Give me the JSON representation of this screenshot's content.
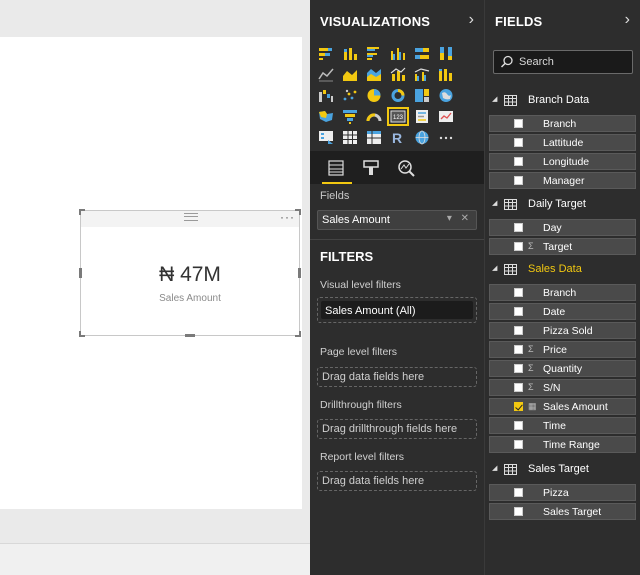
{
  "card": {
    "value": "₦ 47M",
    "label": "Sales Amount",
    "more_glyph": "···"
  },
  "visualizations": {
    "title": "VISUALIZATIONS",
    "icons": [
      "stacked-bar-icon",
      "stacked-column-icon",
      "clustered-bar-icon",
      "clustered-column-icon",
      "100-percent-bar-icon",
      "100-percent-column-icon",
      "line-chart-icon",
      "area-chart-icon",
      "stacked-area-icon",
      "line-column-icon",
      "line-clustered-column-icon",
      "ribbon-chart-icon",
      "waterfall-icon",
      "scatter-icon",
      "pie-chart-icon",
      "donut-chart-icon",
      "treemap-icon",
      "map-icon",
      "filled-map-icon",
      "funnel-icon",
      "gauge-icon",
      "card-icon",
      "multi-row-card-icon",
      "kpi-icon",
      "slicer-icon",
      "table-icon",
      "matrix-icon",
      "r-visual-icon",
      "globe-icon",
      "more-icon"
    ],
    "tabs": [
      "fields-tab-icon",
      "format-tab-icon",
      "analytics-tab-icon"
    ],
    "fields_label": "Fields",
    "well_value": "Sales Amount",
    "well_controls": "▾ ✕"
  },
  "filters": {
    "title": "FILTERS",
    "visual_level_label": "Visual level filters",
    "visual_filter": "Sales Amount  (All)",
    "page_level_label": "Page level filters",
    "page_drop": "Drag data fields here",
    "drillthrough_label": "Drillthrough filters",
    "drillthrough_drop": "Drag drillthrough fields here",
    "report_level_label": "Report level filters",
    "report_drop": "Drag data fields here"
  },
  "fields": {
    "title": "FIELDS",
    "search_placeholder": "Search",
    "tables": [
      {
        "name": "Branch Data",
        "active": false,
        "fields": [
          {
            "label": "Branch",
            "type": "",
            "checked": false
          },
          {
            "label": "Lattitude",
            "type": "",
            "checked": false
          },
          {
            "label": "Longitude",
            "type": "",
            "checked": false
          },
          {
            "label": "Manager",
            "type": "",
            "checked": false
          }
        ]
      },
      {
        "name": "Daily Target",
        "active": false,
        "fields": [
          {
            "label": "Day",
            "type": "",
            "checked": false
          },
          {
            "label": "Target",
            "type": "Σ",
            "checked": false
          }
        ]
      },
      {
        "name": "Sales Data",
        "active": true,
        "fields": [
          {
            "label": "Branch",
            "type": "",
            "checked": false
          },
          {
            "label": "Date",
            "type": "",
            "checked": false
          },
          {
            "label": "Pizza Sold",
            "type": "",
            "checked": false
          },
          {
            "label": "Price",
            "type": "Σ",
            "checked": false
          },
          {
            "label": "Quantity",
            "type": "Σ",
            "checked": false
          },
          {
            "label": "S/N",
            "type": "Σ",
            "checked": false
          },
          {
            "label": "Sales Amount",
            "type": "▦",
            "checked": true
          },
          {
            "label": "Time",
            "type": "",
            "checked": false
          },
          {
            "label": "Time Range",
            "type": "",
            "checked": false
          }
        ]
      },
      {
        "name": "Sales Target",
        "active": false,
        "fields": [
          {
            "label": "Pizza",
            "type": "",
            "checked": false
          },
          {
            "label": "Sales Target",
            "type": "",
            "checked": false
          }
        ]
      }
    ]
  },
  "colors": {
    "accent": "#f2c811",
    "pane_bg": "#2d2d2d",
    "canvas_bg": "#eaeaea"
  }
}
